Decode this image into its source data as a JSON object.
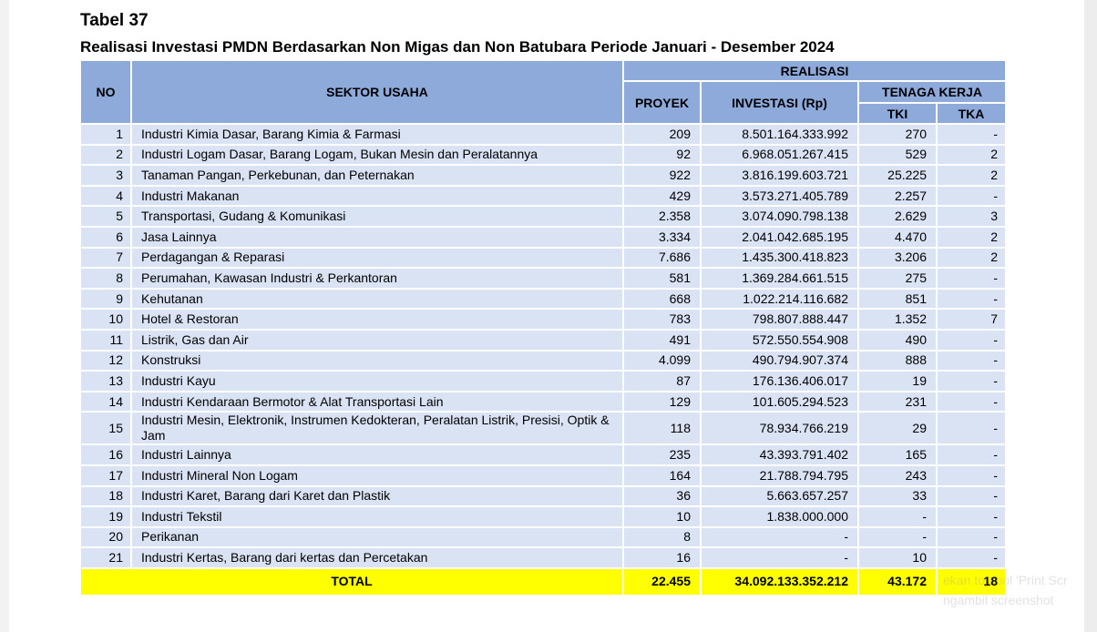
{
  "title": "Tabel 37",
  "subtitle": "Realisasi Investasi PMDN Berdasarkan Non Migas dan Non Batubara Periode Januari - Desember 2024",
  "headers": {
    "no": "NO",
    "sektor": "SEKTOR USAHA",
    "realisasi": "REALISASI",
    "proyek": "PROYEK",
    "investasi": "INVESTASI (Rp)",
    "tenaga_kerja": "TENAGA KERJA",
    "tki": "TKI",
    "tka": "TKA"
  },
  "rows": [
    {
      "no": "1",
      "sektor": "Industri Kimia Dasar, Barang Kimia & Farmasi",
      "proyek": "209",
      "investasi": "8.501.164.333.992",
      "tki": "270",
      "tka": "-"
    },
    {
      "no": "2",
      "sektor": "Industri Logam Dasar, Barang Logam, Bukan Mesin dan Peralatannya",
      "proyek": "92",
      "investasi": "6.968.051.267.415",
      "tki": "529",
      "tka": "2"
    },
    {
      "no": "3",
      "sektor": "Tanaman Pangan, Perkebunan, dan Peternakan",
      "proyek": "922",
      "investasi": "3.816.199.603.721",
      "tki": "25.225",
      "tka": "2"
    },
    {
      "no": "4",
      "sektor": "Industri Makanan",
      "proyek": "429",
      "investasi": "3.573.271.405.789",
      "tki": "2.257",
      "tka": "-"
    },
    {
      "no": "5",
      "sektor": "Transportasi, Gudang & Komunikasi",
      "proyek": "2.358",
      "investasi": "3.074.090.798.138",
      "tki": "2.629",
      "tka": "3"
    },
    {
      "no": "6",
      "sektor": "Jasa Lainnya",
      "proyek": "3.334",
      "investasi": "2.041.042.685.195",
      "tki": "4.470",
      "tka": "2"
    },
    {
      "no": "7",
      "sektor": "Perdagangan & Reparasi",
      "proyek": "7.686",
      "investasi": "1.435.300.418.823",
      "tki": "3.206",
      "tka": "2"
    },
    {
      "no": "8",
      "sektor": "Perumahan, Kawasan Industri & Perkantoran",
      "proyek": "581",
      "investasi": "1.369.284.661.515",
      "tki": "275",
      "tka": "-"
    },
    {
      "no": "9",
      "sektor": "Kehutanan",
      "proyek": "668",
      "investasi": "1.022.214.116.682",
      "tki": "851",
      "tka": "-"
    },
    {
      "no": "10",
      "sektor": "Hotel & Restoran",
      "proyek": "783",
      "investasi": "798.807.888.447",
      "tki": "1.352",
      "tka": "7"
    },
    {
      "no": "11",
      "sektor": "Listrik, Gas dan Air",
      "proyek": "491",
      "investasi": "572.550.554.908",
      "tki": "490",
      "tka": "-"
    },
    {
      "no": "12",
      "sektor": "Konstruksi",
      "proyek": "4.099",
      "investasi": "490.794.907.374",
      "tki": "888",
      "tka": "-"
    },
    {
      "no": "13",
      "sektor": "Industri Kayu",
      "proyek": "87",
      "investasi": "176.136.406.017",
      "tki": "19",
      "tka": "-"
    },
    {
      "no": "14",
      "sektor": "Industri Kendaraan Bermotor & Alat Transportasi Lain",
      "proyek": "129",
      "investasi": "101.605.294.523",
      "tki": "231",
      "tka": "-"
    },
    {
      "no": "15",
      "sektor": "Industri Mesin, Elektronik, Instrumen Kedokteran, Peralatan Listrik, Presisi, Optik & Jam",
      "proyek": "118",
      "investasi": "78.934.766.219",
      "tki": "29",
      "tka": "-"
    },
    {
      "no": "16",
      "sektor": "Industri Lainnya",
      "proyek": "235",
      "investasi": "43.393.791.402",
      "tki": "165",
      "tka": "-"
    },
    {
      "no": "17",
      "sektor": "Industri Mineral Non Logam",
      "proyek": "164",
      "investasi": "21.788.794.795",
      "tki": "243",
      "tka": "-"
    },
    {
      "no": "18",
      "sektor": "Industri Karet, Barang dari Karet dan Plastik",
      "proyek": "36",
      "investasi": "5.663.657.257",
      "tki": "33",
      "tka": "-"
    },
    {
      "no": "19",
      "sektor": "Industri Tekstil",
      "proyek": "10",
      "investasi": "1.838.000.000",
      "tki": "-",
      "tka": "-"
    },
    {
      "no": "20",
      "sektor": "Perikanan",
      "proyek": "8",
      "investasi": "-",
      "tki": "-",
      "tka": "-"
    },
    {
      "no": "21",
      "sektor": "Industri Kertas, Barang dari kertas dan Percetakan",
      "proyek": "16",
      "investasi": "-",
      "tki": "10",
      "tka": "-"
    }
  ],
  "total": {
    "label": "TOTAL",
    "proyek": "22.455",
    "investasi": "34.092.133.352.212",
    "tki": "43.172",
    "tka": "18"
  },
  "watermark": [
    "ekan tombol 'Print Scr",
    "ngambil screenshot"
  ],
  "colors": {
    "header_bg": "#8eaadb",
    "row_bg": "#dae3f3",
    "total_bg": "#ffff00"
  }
}
